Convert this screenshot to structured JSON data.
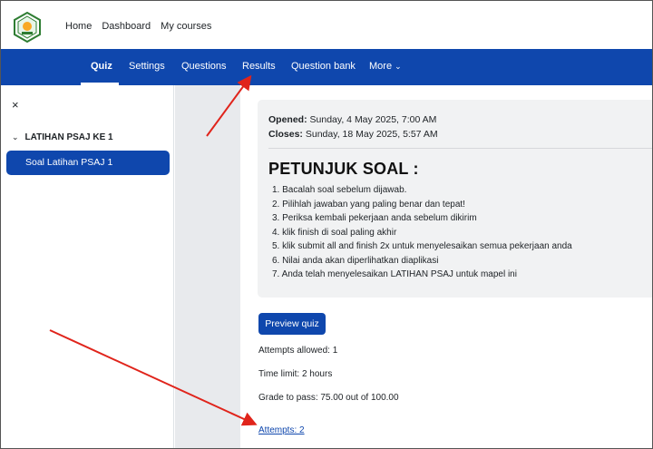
{
  "topnav": {
    "home": "Home",
    "dashboard": "Dashboard",
    "my_courses": "My courses"
  },
  "secondary_nav": {
    "quiz": "Quiz",
    "settings": "Settings",
    "questions": "Questions",
    "results": "Results",
    "question_bank": "Question bank",
    "more": "More"
  },
  "drawer": {
    "close": "×",
    "section_title": "LATIHAN PSAJ KE 1",
    "activity_label": "Soal Latihan PSAJ 1"
  },
  "quiz": {
    "opened_label": "Opened:",
    "opened_value": "Sunday, 4 May 2025, 7:00 AM",
    "closes_label": "Closes:",
    "closes_value": "Sunday, 18 May 2025, 5:57 AM",
    "heading": "PETUNJUK SOAL :",
    "instructions": [
      "1. Bacalah soal sebelum dijawab.",
      "2. Pilihlah jawaban yang paling benar dan tepat!",
      "3. Periksa kembali pekerjaan anda sebelum dikirim",
      "4. klik finish di soal paling akhir",
      "5. klik submit all and finish 2x untuk menyelesaikan semua pekerjaan anda",
      "6. Nilai anda akan diperlihatkan diaplikasi",
      "7. Anda telah menyelesaikan LATIHAN PSAJ untuk mapel ini"
    ],
    "preview_button": "Preview quiz",
    "attempts_allowed": "Attempts allowed: 1",
    "time_limit": "Time limit: 2 hours",
    "grade_to_pass": "Grade to pass: 75.00 out of 100.00",
    "attempts_link": "Attempts: 2"
  },
  "colors": {
    "brand": "#0f47ad",
    "annotation_arrow": "#e0241b"
  }
}
